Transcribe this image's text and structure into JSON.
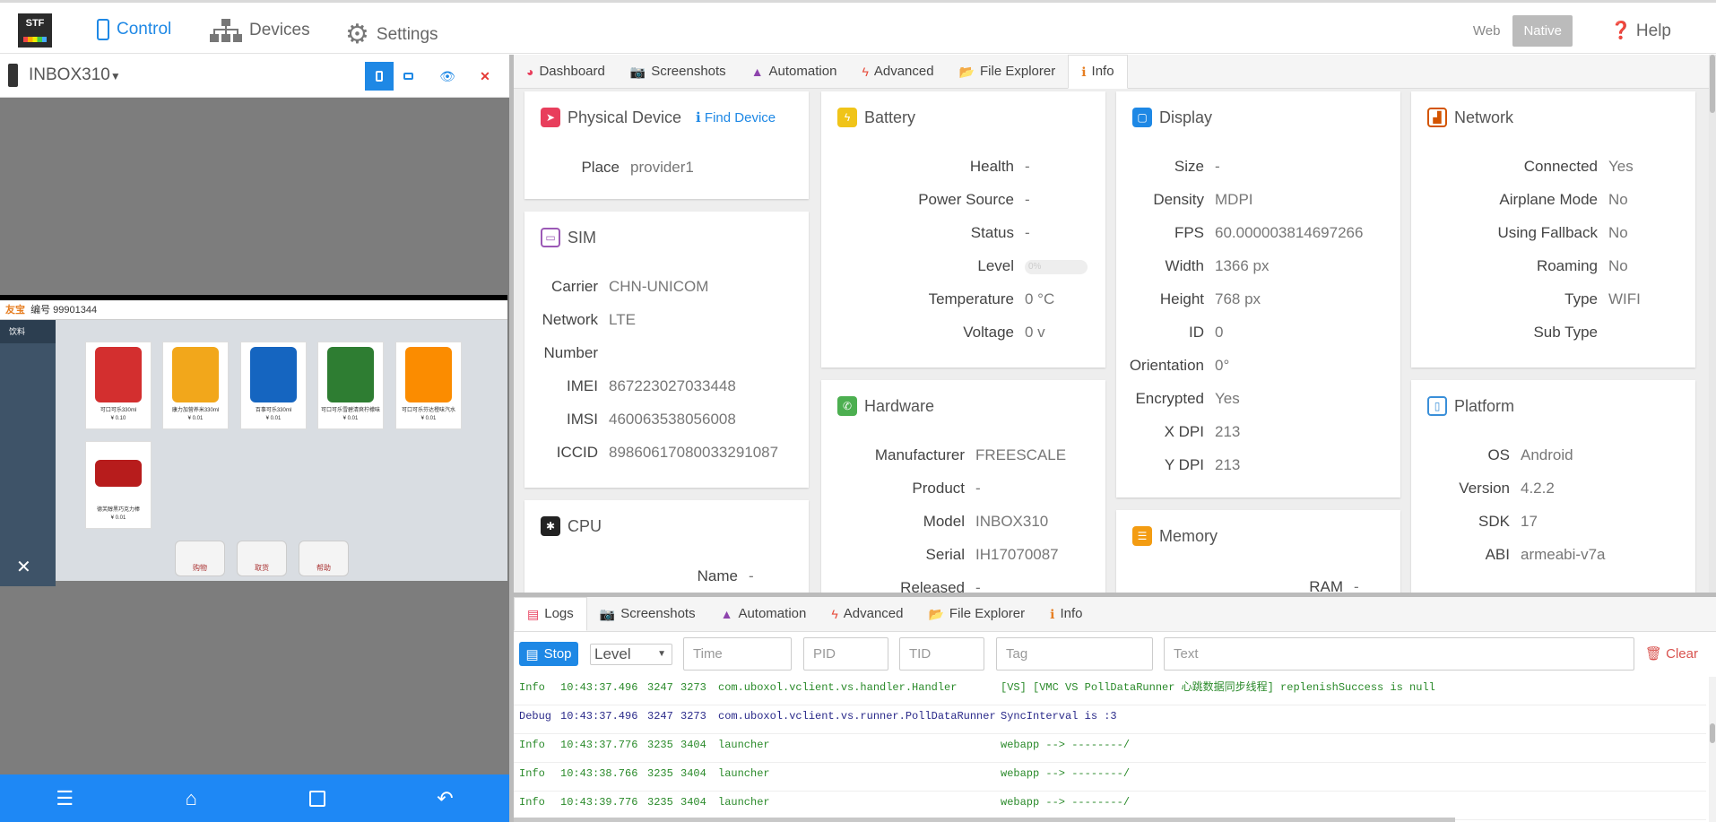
{
  "topnav": {
    "logo": "STF",
    "items": [
      {
        "label": "Control",
        "active": true
      },
      {
        "label": "Devices",
        "active": false
      },
      {
        "label": "Settings",
        "active": false
      }
    ],
    "web": "Web",
    "native": "Native",
    "help": "Help"
  },
  "device": {
    "name": "INBOX310",
    "screen": {
      "brand": "友宝",
      "machine_no": "编号 99901344",
      "category": "饮料",
      "products": [
        {
          "name": "可口可乐330ml",
          "price": "¥ 0.10",
          "color": "#d32f2f"
        },
        {
          "name": "康力加营养米330ml",
          "price": "¥ 0.01",
          "color": "#f2a71b"
        },
        {
          "name": "百事可乐330ml",
          "price": "¥ 0.01",
          "color": "#1565c0"
        },
        {
          "name": "可口可乐雪碧清爽柠檬味",
          "price": "¥ 0.01",
          "color": "#2e7d32"
        },
        {
          "name": "可口可乐芬达橙味汽水",
          "price": "¥ 0.01",
          "color": "#fb8c00"
        },
        {
          "name": "德芙醇黑巧克力棒",
          "price": "¥ 0.01",
          "color": "#b71c1c"
        }
      ],
      "bottom_buttons": [
        "购物",
        "取货",
        "帮助"
      ]
    }
  },
  "tabs": [
    "Dashboard",
    "Screenshots",
    "Automation",
    "Advanced",
    "File Explorer",
    "Info"
  ],
  "physical": {
    "title": "Physical Device",
    "find": "Find Device",
    "place_k": "Place",
    "place_v": "provider1"
  },
  "sim": {
    "title": "SIM",
    "rows": [
      [
        "Carrier",
        "CHN-UNICOM"
      ],
      [
        "Network",
        "LTE"
      ],
      [
        "Number",
        ""
      ],
      [
        "IMEI",
        "867223027033448"
      ],
      [
        "IMSI",
        "460063538056008"
      ],
      [
        "ICCID",
        "89860617080033291087"
      ]
    ]
  },
  "cpu": {
    "title": "CPU",
    "name_k": "Name",
    "name_v": "-"
  },
  "battery": {
    "title": "Battery",
    "rows": [
      [
        "Health",
        "-"
      ],
      [
        "Power Source",
        "-"
      ],
      [
        "Status",
        "-"
      ],
      [
        "Level",
        ""
      ],
      [
        "Temperature",
        "0 °C"
      ],
      [
        "Voltage",
        "0 v"
      ]
    ],
    "level_value": "0%"
  },
  "hardware": {
    "title": "Hardware",
    "rows": [
      [
        "Manufacturer",
        "FREESCALE"
      ],
      [
        "Product",
        "-"
      ],
      [
        "Model",
        "INBOX310"
      ],
      [
        "Serial",
        "IH17070087"
      ],
      [
        "Released",
        "-"
      ]
    ]
  },
  "display": {
    "title": "Display",
    "rows": [
      [
        "Size",
        "-"
      ],
      [
        "Density",
        "MDPI"
      ],
      [
        "FPS",
        "60.000003814697266"
      ],
      [
        "Width",
        "1366 px"
      ],
      [
        "Height",
        "768 px"
      ],
      [
        "ID",
        "0"
      ],
      [
        "Orientation",
        "0°"
      ],
      [
        "Encrypted",
        "Yes"
      ],
      [
        "X DPI",
        "213"
      ],
      [
        "Y DPI",
        "213"
      ]
    ]
  },
  "memory": {
    "title": "Memory",
    "ram_k": "RAM",
    "ram_v": "-"
  },
  "network": {
    "title": "Network",
    "rows": [
      [
        "Connected",
        "Yes"
      ],
      [
        "Airplane Mode",
        "No"
      ],
      [
        "Using Fallback",
        "No"
      ],
      [
        "Roaming",
        "No"
      ],
      [
        "Type",
        "WIFI"
      ],
      [
        "Sub Type",
        ""
      ]
    ]
  },
  "platform": {
    "title": "Platform",
    "rows": [
      [
        "OS",
        "Android"
      ],
      [
        "Version",
        "4.2.2"
      ],
      [
        "SDK",
        "17"
      ],
      [
        "ABI",
        "armeabi-v7a"
      ]
    ]
  },
  "logtabs": [
    "Logs",
    "Screenshots",
    "Automation",
    "Advanced",
    "File Explorer",
    "Info"
  ],
  "filters": {
    "stop": "Stop",
    "level": "Level",
    "time": "Time",
    "pid": "PID",
    "tid": "TID",
    "tag": "Tag",
    "text": "Text",
    "clear": "Clear"
  },
  "logs": [
    {
      "level": "Info",
      "time": "10:43:37.496",
      "pid": "3247",
      "tid": "3273",
      "tag": "com.uboxol.vclient.vs.handler.Handler",
      "msg": "[VS] [VMC VS PollDataRunner 心跳数据同步线程] replenishSuccess is null"
    },
    {
      "level": "Debug",
      "time": "10:43:37.496",
      "pid": "3247",
      "tid": "3273",
      "tag": "com.uboxol.vclient.vs.runner.PollDataRunner",
      "msg": "SyncInterval is :3"
    },
    {
      "level": "Info",
      "time": "10:43:37.776",
      "pid": "3235",
      "tid": "3404",
      "tag": "launcher",
      "msg": "webapp  --> --------/"
    },
    {
      "level": "Info",
      "time": "10:43:38.766",
      "pid": "3235",
      "tid": "3404",
      "tag": "launcher",
      "msg": "webapp  --> --------/"
    },
    {
      "level": "Info",
      "time": "10:43:39.776",
      "pid": "3235",
      "tid": "3404",
      "tag": "launcher",
      "msg": "webapp  --> --------/"
    }
  ]
}
